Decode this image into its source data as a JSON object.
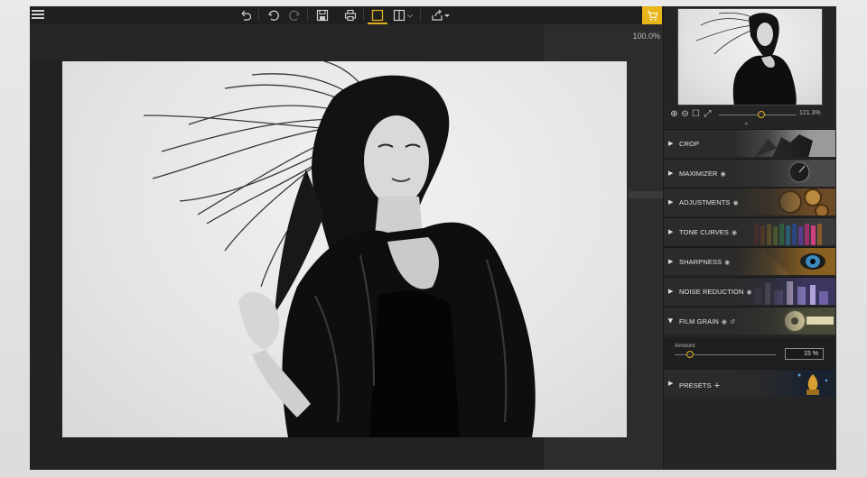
{
  "toolbar": {
    "icons": [
      "menu-icon",
      "undo-all-icon",
      "undo-icon",
      "redo-icon",
      "save-icon",
      "print-icon",
      "single-view-icon",
      "split-view-icon",
      "share-icon",
      "cart-icon"
    ],
    "accent": "#e8b519"
  },
  "workspace": {
    "zoom_label": "100.0%"
  },
  "navigator": {
    "zoom_value": "121.3%",
    "zoom_icons": [
      "zoom-in-icon",
      "zoom-out-icon",
      "fit-icon",
      "actual-size-icon"
    ]
  },
  "panels": [
    {
      "label": "CROP",
      "eye": false
    },
    {
      "label": "MAXIMIZER",
      "eye": true
    },
    {
      "label": "ADJUSTMENTS",
      "eye": true
    },
    {
      "label": "TONE CURVES",
      "eye": true
    },
    {
      "label": "SHARPNESS",
      "eye": true
    },
    {
      "label": "NOISE REDUCTION",
      "eye": true
    },
    {
      "label": "FILM GRAIN",
      "eye": true,
      "expanded": true
    }
  ],
  "film_grain": {
    "amount_label": "Amount",
    "amount_value": "15 %",
    "amount_fraction": 0.15
  },
  "presets": {
    "label": "PRESETS"
  }
}
